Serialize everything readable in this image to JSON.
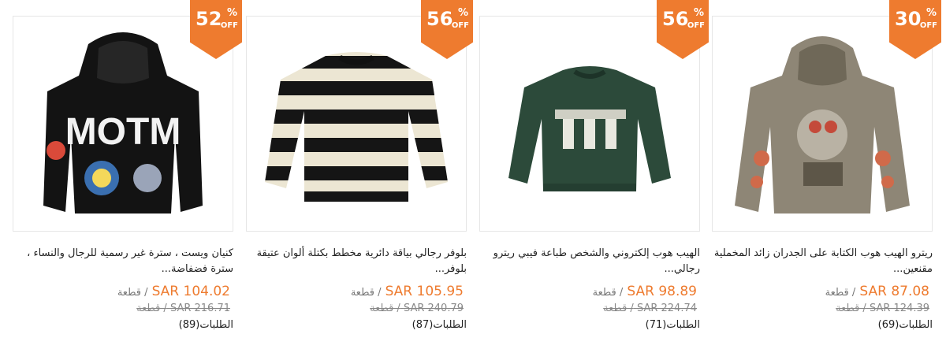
{
  "colors": {
    "accent": "#ee7b2f",
    "border": "#e6e6e6"
  },
  "products": [
    {
      "discount": "30",
      "pct": "%",
      "off": "OFF",
      "title": "ريترو الهيب هوب الكتابة على الجدران زائد المخملية مقنعين...",
      "price": "SAR 87.08",
      "unit": "/ قطعة",
      "old_price": "SAR 124.39",
      "old_unit": "/ قطعة",
      "orders": "الطلبات(69)",
      "image_icon": "hoodie-graffiti-khaki-icon"
    },
    {
      "discount": "56",
      "pct": "%",
      "off": "OFF",
      "title": "الهيب هوب إلكتروني والشخص طباعة فيبي ريترو رجالي...",
      "price": "SAR 98.89",
      "unit": "/ قطعة",
      "old_price": "SAR 224.74",
      "old_unit": "/ قطعة",
      "orders": "الطلبات(71)",
      "image_icon": "green-sweater-icon"
    },
    {
      "discount": "56",
      "pct": "%",
      "off": "OFF",
      "title": "بلوفر رجالي بياقة دائرية مخطط بكتلة ألوان عتيقة بلوفر...",
      "price": "SAR 105.95",
      "unit": "/ قطعة",
      "old_price": "SAR 240.79",
      "old_unit": "/ قطعة",
      "orders": "الطلبات(87)",
      "image_icon": "striped-sweater-icon"
    },
    {
      "discount": "52",
      "pct": "%",
      "off": "OFF",
      "title": "كنيان ويست ، سترة غير رسمية للرجال والنساء ، سترة فضفاضة...",
      "price": "SAR 104.02",
      "unit": "/ قطعة",
      "old_price": "SAR 216.71",
      "old_unit": "/ قطعة",
      "orders": "الطلبات(89)",
      "image_icon": "black-hoodie-icon",
      "print_text": "MOTM"
    }
  ]
}
